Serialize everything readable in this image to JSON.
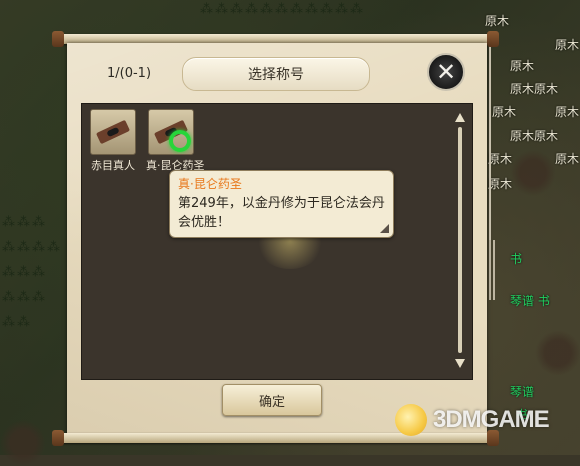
{
  "map": {
    "labels": [
      "原木",
      "原木",
      "原木",
      "原木原木",
      "原木",
      "原木",
      "原木原木",
      "原木",
      "原木",
      "原木"
    ],
    "green_labels": [
      "琴谱 书",
      "琴谱",
      "书"
    ]
  },
  "dialog": {
    "count": "1/(0-1)",
    "title": "选择称号",
    "close_symbol": "✕",
    "titles": [
      {
        "name": "赤目真人",
        "selected": false
      },
      {
        "name": "真·昆仑药圣",
        "selected": true
      }
    ],
    "tooltip": {
      "name": "真·昆仑药圣",
      "description": "第249年，以金丹修为于昆仑法会丹会优胜！"
    },
    "confirm_label": "确定"
  },
  "watermark": {
    "text": "3DMGAME"
  },
  "colors": {
    "selected_ring": "#27d53a",
    "title_name": "#e8771a"
  }
}
